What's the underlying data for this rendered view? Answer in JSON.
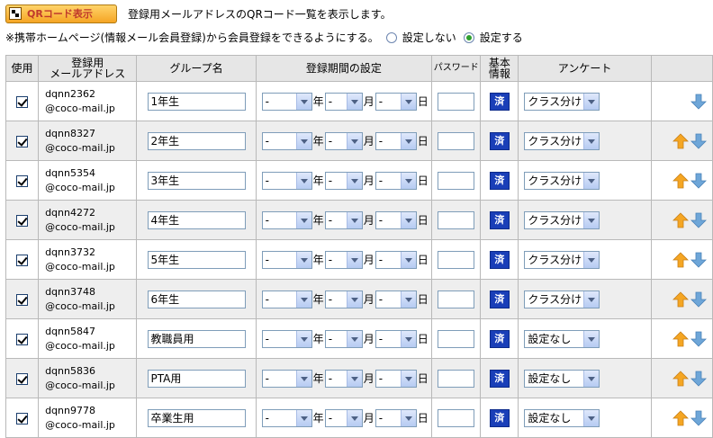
{
  "header": {
    "qr_button_label": "QRコード表示",
    "description": "登録用メールアドレスのQRコード一覧を表示します。"
  },
  "notice": {
    "text": "※携帯ホームページ(情報メール会員登録)から会員登録をできるようにする。",
    "option_off": "設定しない",
    "option_on": "設定する",
    "selected": "設定する"
  },
  "columns": {
    "use": "使用",
    "address": "登録用\nメールアドレス",
    "group": "グループ名",
    "period": "登録期間の設定",
    "password": "パスワード",
    "basic_info": "基本\n情報",
    "survey": "アンケート"
  },
  "period_units": {
    "year": "年",
    "month": "月",
    "day": "日"
  },
  "basic_info_badge": "済",
  "rows": [
    {
      "checked": true,
      "id": "dqnn2362",
      "domain": "@coco-mail.jp",
      "group": "1年生",
      "y": "-",
      "m": "-",
      "d": "-",
      "survey": "クラス分け",
      "up": false,
      "down": true
    },
    {
      "checked": true,
      "id": "dqnn8327",
      "domain": "@coco-mail.jp",
      "group": "2年生",
      "y": "-",
      "m": "-",
      "d": "-",
      "survey": "クラス分け",
      "up": true,
      "down": true
    },
    {
      "checked": true,
      "id": "dqnn5354",
      "domain": "@coco-mail.jp",
      "group": "3年生",
      "y": "-",
      "m": "-",
      "d": "-",
      "survey": "クラス分け",
      "up": true,
      "down": true
    },
    {
      "checked": true,
      "id": "dqnn4272",
      "domain": "@coco-mail.jp",
      "group": "4年生",
      "y": "-",
      "m": "-",
      "d": "-",
      "survey": "クラス分け",
      "up": true,
      "down": true
    },
    {
      "checked": true,
      "id": "dqnn3732",
      "domain": "@coco-mail.jp",
      "group": "5年生",
      "y": "-",
      "m": "-",
      "d": "-",
      "survey": "クラス分け",
      "up": true,
      "down": true
    },
    {
      "checked": true,
      "id": "dqnn3748",
      "domain": "@coco-mail.jp",
      "group": "6年生",
      "y": "-",
      "m": "-",
      "d": "-",
      "survey": "クラス分け",
      "up": true,
      "down": true
    },
    {
      "checked": true,
      "id": "dqnn5847",
      "domain": "@coco-mail.jp",
      "group": "教職員用",
      "y": "-",
      "m": "-",
      "d": "-",
      "survey": "設定なし",
      "up": true,
      "down": true
    },
    {
      "checked": true,
      "id": "dqnn5836",
      "domain": "@coco-mail.jp",
      "group": "PTA用",
      "y": "-",
      "m": "-",
      "d": "-",
      "survey": "設定なし",
      "up": true,
      "down": true
    },
    {
      "checked": true,
      "id": "dqnn9778",
      "domain": "@coco-mail.jp",
      "group": "卒業生用",
      "y": "-",
      "m": "-",
      "d": "-",
      "survey": "設定なし",
      "up": true,
      "down": true
    }
  ],
  "colors": {
    "up_arrow": "#f5a623",
    "down_arrow": "#6ea6d8",
    "badge": "#1a3fb8",
    "radio_selected": "#2ea02e"
  },
  "icons": {
    "qr": "qr-code-icon",
    "up": "arrow-up-icon",
    "down": "arrow-down-icon"
  }
}
